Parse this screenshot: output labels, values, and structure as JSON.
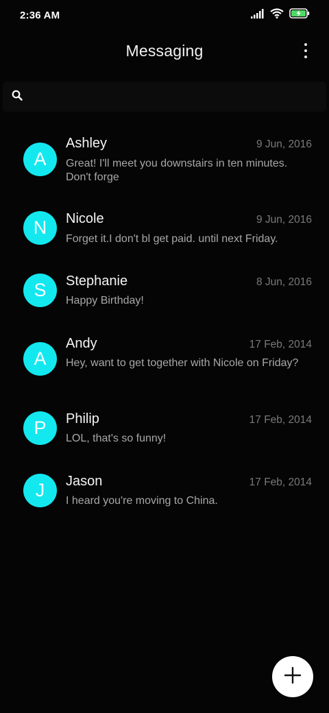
{
  "status_bar": {
    "time": "2:36 AM",
    "icons": [
      "signal-icon",
      "wifi-icon",
      "battery-charging-icon"
    ],
    "battery_color": "#4cd964"
  },
  "header": {
    "title": "Messaging",
    "menu_icon": "more-vertical-icon"
  },
  "search": {
    "icon": "search-icon",
    "value": "",
    "placeholder": ""
  },
  "conversations": [
    {
      "initial": "A",
      "name": "Ashley",
      "date": "9 Jun, 2016",
      "snippet": "Great! I'll meet you downstairs in ten minutes. Don't forge"
    },
    {
      "initial": "N",
      "name": "Nicole",
      "date": "9 Jun, 2016",
      "snippet": "Forget it.I don't bl get paid. until next Friday."
    },
    {
      "initial": "S",
      "name": "Stephanie",
      "date": "8 Jun, 2016",
      "snippet": "Happy Birthday!"
    },
    {
      "initial": "A",
      "name": "Andy",
      "date": "17 Feb, 2014",
      "snippet": "Hey, want to get together with Nicole on Friday?"
    },
    {
      "initial": "P",
      "name": "Philip",
      "date": "17 Feb, 2014",
      "snippet": "LOL, that's so funny!"
    },
    {
      "initial": "J",
      "name": "Jason",
      "date": "17 Feb, 2014",
      "snippet": "I heard you're moving to China."
    }
  ],
  "fab": {
    "icon": "plus-icon"
  },
  "colors": {
    "background": "#050505",
    "avatar": "#13e8ef",
    "fab": "#ffffff"
  }
}
